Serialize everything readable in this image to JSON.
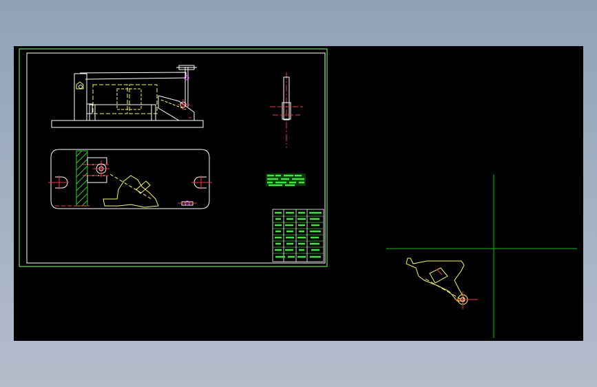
{
  "viewer": {
    "background": "#000000"
  },
  "colors": {
    "frame": "#66dd55",
    "line": "#ffffff",
    "part": "#ffff44",
    "center": "#ff3333",
    "accent": "#ff66ff",
    "hatch": "#33cc33",
    "crosshair": "#00cc00"
  }
}
